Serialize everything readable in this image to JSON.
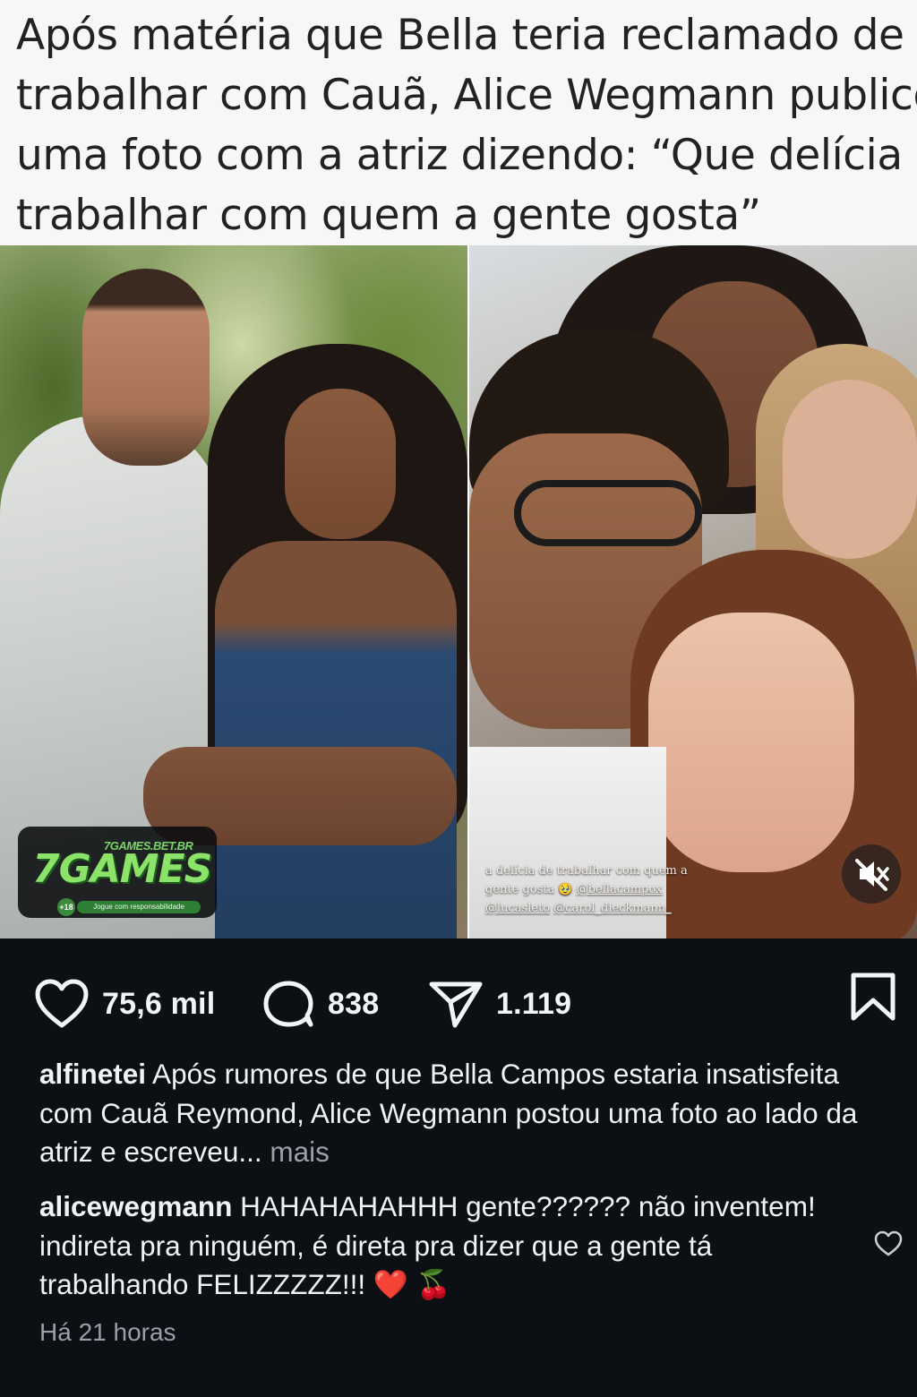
{
  "headline": {
    "text": "Após matéria que Bella teria reclamado de\ntrabalhar com Cauã, Alice Wegmann publicou\numa foto com a atriz dizendo: “Que delícia\ntrabalhar com quem a gente gosta”"
  },
  "watermark": {
    "domain": "7GAMES.BET.BR",
    "logo": "7GAMES",
    "age": "+18",
    "note": "Jogue com responsabilidade"
  },
  "story_caption": {
    "line1": "a delícia de trabalhar com quem a",
    "line2": "gente gosta 🥹 ",
    "mention1": "@bellacampox",
    "mention2": "@lucasleto",
    "mention3": "@carol_dieckmann_"
  },
  "actions": {
    "likes": "75,6 mil",
    "comments": "838",
    "shares": "1.119"
  },
  "caption": {
    "username": "alfinetei",
    "text": " Após rumores de que Bella Campos estaria insatisfeita com Cauã Reymond, Alice Wegmann postou uma foto ao lado da atriz e escreveu...",
    "more": " mais"
  },
  "comment": {
    "username": "alicewegmann",
    "text": " HAHAHAHAHHH gente?????? não inventem! indireta pra ninguém, é direta pra dizer que a gente tá trabalhando FELIZZZZZ!!! ❤️ 🍒"
  },
  "timestamp": "Há 21 horas",
  "icons": {
    "like": "heart-icon",
    "comment": "comment-bubble-icon",
    "share": "paper-plane-icon",
    "save": "bookmark-icon",
    "mute": "speaker-muted-icon",
    "comment_like": "heart-outline-icon"
  },
  "colors": {
    "background": "#0c0f14",
    "text": "#f1f2f4",
    "muted": "#9aa0a8",
    "headline_bg": "#f7f7f7",
    "brand_green": "#8be36a"
  }
}
